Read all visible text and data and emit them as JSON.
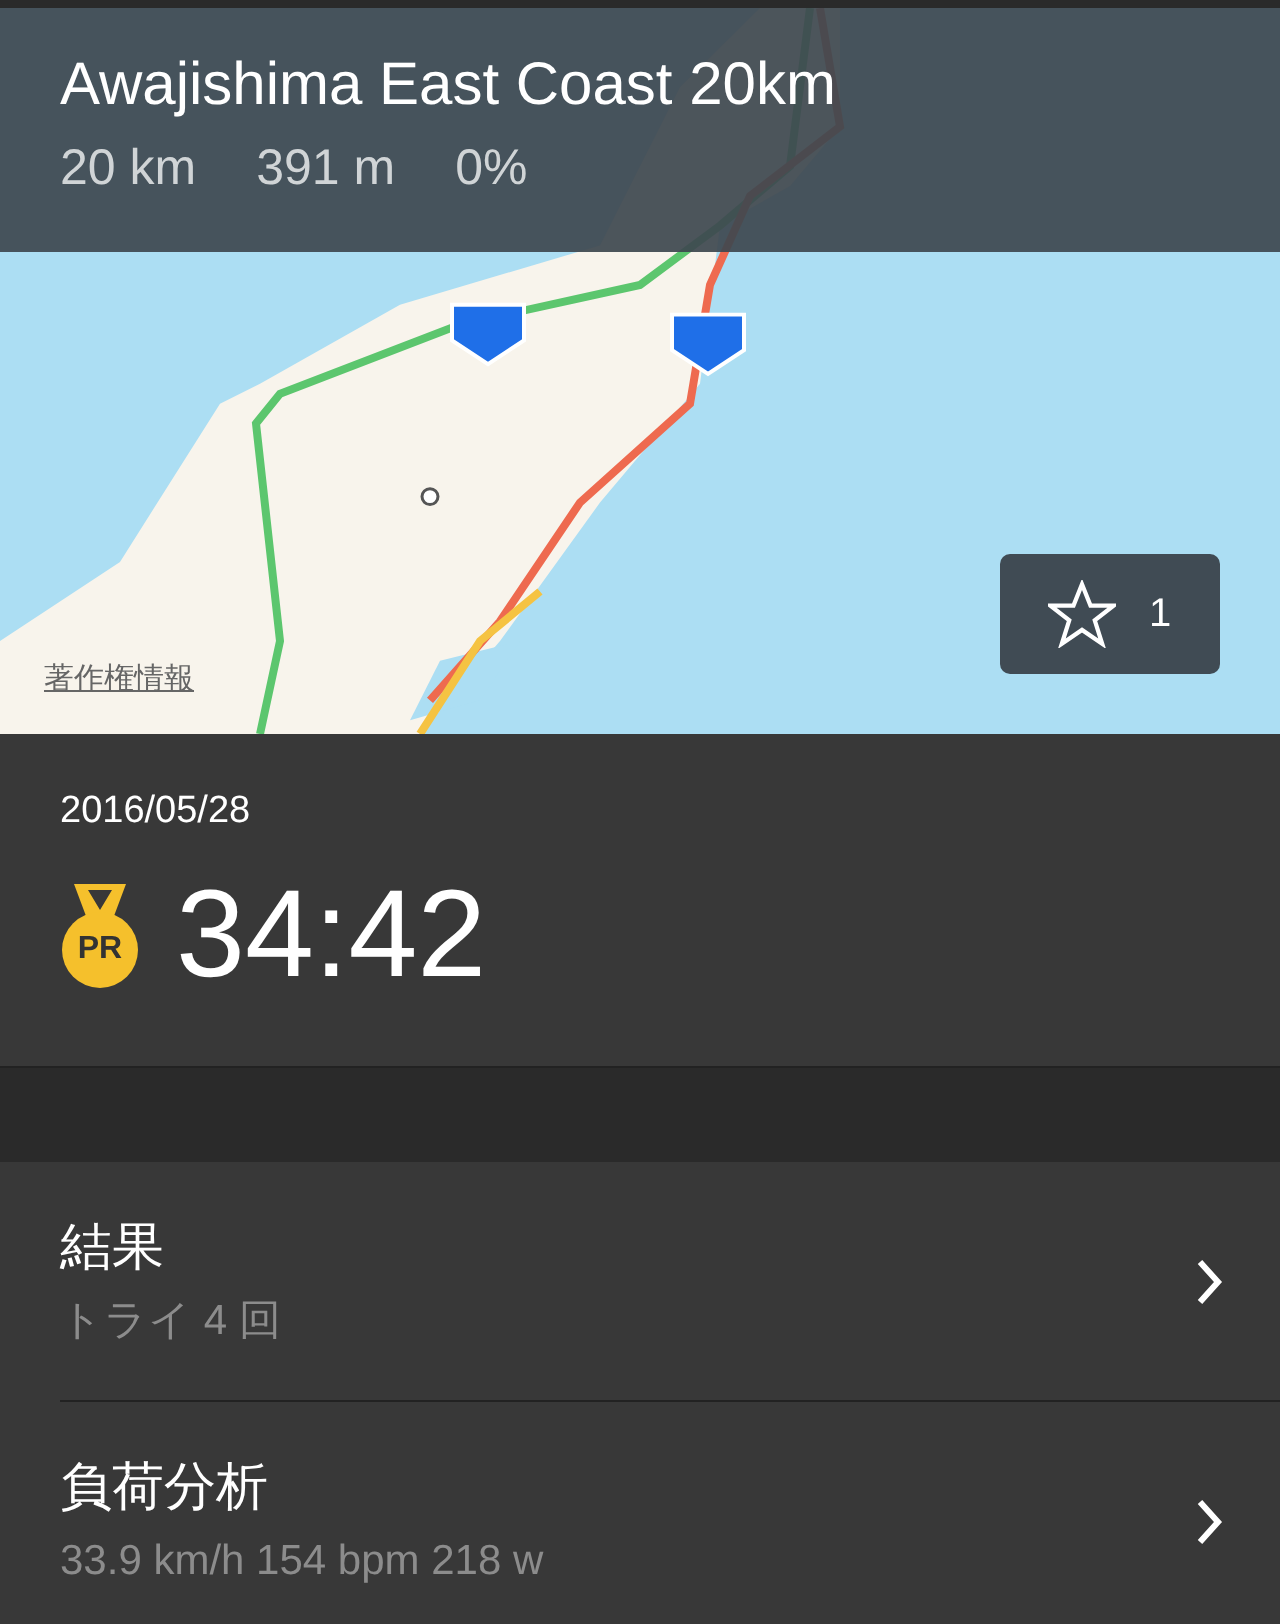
{
  "header": {
    "title": "Awajishima East Coast 20km",
    "stats": [
      "20 km",
      "391 m",
      "0%"
    ]
  },
  "map": {
    "kind": "picture",
    "attribution": "著作権情報",
    "favorites": {
      "count": "1",
      "selected": false
    }
  },
  "result": {
    "date": "2016/05/28",
    "badge": "PR",
    "time": "34:42"
  },
  "rows": [
    {
      "title": "結果",
      "subtitle": "トライ 4 回"
    },
    {
      "title": "負荷分析",
      "subtitle": "33.9 km/h 154 bpm 218 w"
    }
  ]
}
